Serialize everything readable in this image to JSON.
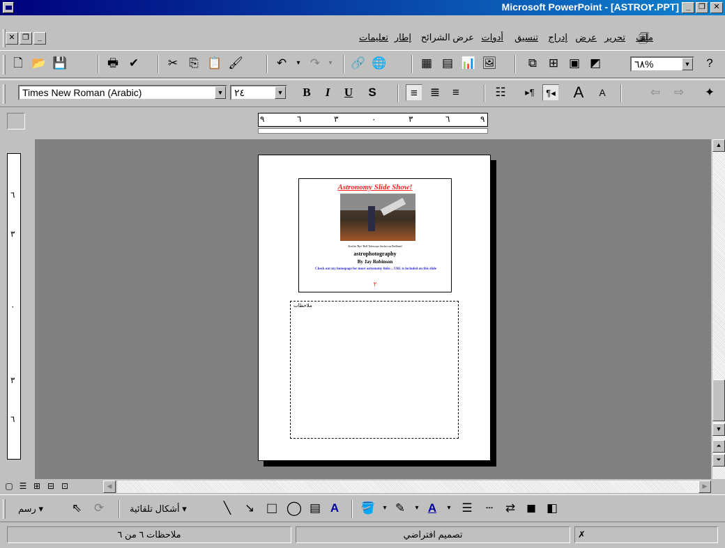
{
  "window": {
    "title": "Microsoft PowerPoint - [ASTRO۲.PPT]"
  },
  "menus": [
    "ملف",
    "تحرير",
    "عرض",
    "إدراج",
    "تنسيق",
    "أدوات",
    "عرض الشرائح",
    "إطار",
    "تعليمات"
  ],
  "toolbar_standard": {
    "zoom": "٦٨%"
  },
  "toolbar_formatting": {
    "font": "Times New Roman (Arabic)",
    "size": "٢٤"
  },
  "ruler_h": [
    "٩",
    "٦",
    "٣",
    "٠",
    "٣",
    "٦",
    "٩"
  ],
  "ruler_v": [
    "٦",
    "٣",
    "٠",
    "٣",
    "٦"
  ],
  "slide": {
    "title": "Astronomy Slide Show!",
    "caption": "Kreilin 'Rye' Bell Telescope Sucker on Redlined",
    "line1": "astrophotography",
    "line2": "By Jay Robinson",
    "blue_text": "Check out my homepage for more astronomy links .. URL is included on this slide",
    "page_number": "٢"
  },
  "notes_placeholder": "ملاحظات",
  "drawing_toolbar": {
    "draw_label": "رسم",
    "autoshapes_label": "أشكال تلقائية"
  },
  "status": {
    "pane1": "ملاحظات ٦ من ٦",
    "pane2": "تصميم افتراضي"
  }
}
